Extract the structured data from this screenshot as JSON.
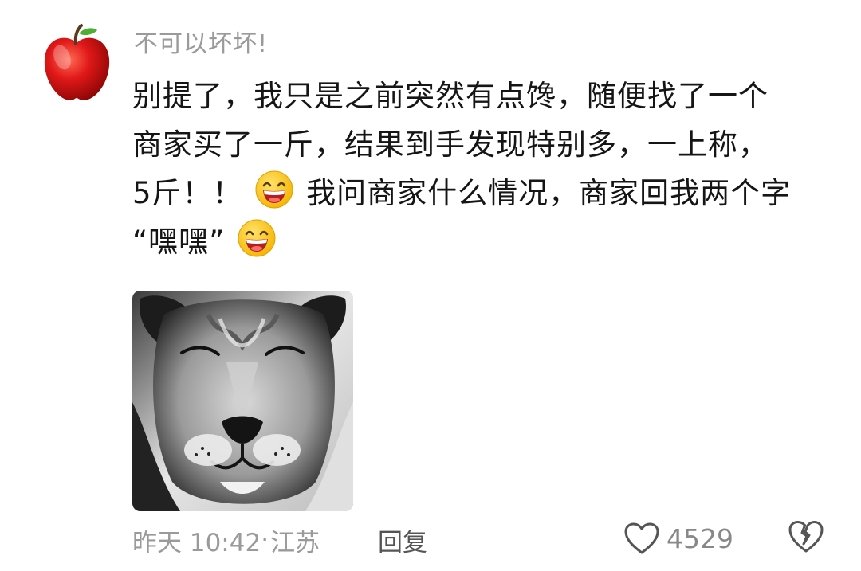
{
  "comment": {
    "username": "不可以坏坏!",
    "avatar_icon": "red-apple-avatar",
    "content_lines": [
      "别提了，我只是之前突然有点馋，随便找了一个",
      "商家买了一斤，结果到手发现特别多，一上称，",
      "5斤！！",
      "我问商家什么情况，商家回我两个字",
      "“嘿嘿”"
    ],
    "emoji_icon": "grinning-face-emoji",
    "image_icon": "lion-face-photo",
    "time": "昨天 10:42",
    "separator": "·",
    "location": "江苏",
    "reply_label": "回复",
    "like_icon": "heart-outline-icon",
    "like_count": "4529",
    "dislike_icon": "broken-heart-icon"
  }
}
